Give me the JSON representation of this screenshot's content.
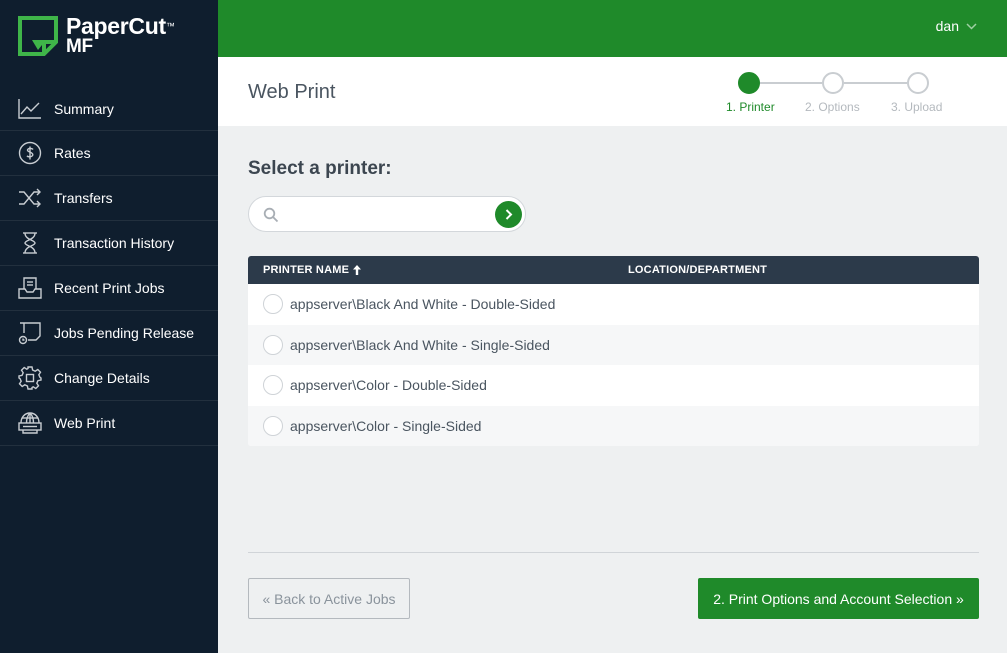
{
  "brand": {
    "name": "PaperCut",
    "trademark": "™",
    "edition": "MF",
    "colors": {
      "accent": "#1f8a2a",
      "sidebar": "#0f1e2e",
      "table_header": "#2c3a4a"
    }
  },
  "sidebar": {
    "items": [
      {
        "label": "Summary",
        "icon": "chart-line-icon"
      },
      {
        "label": "Rates",
        "icon": "dollar-circle-icon"
      },
      {
        "label": "Transfers",
        "icon": "shuffle-icon"
      },
      {
        "label": "Transaction History",
        "icon": "hourglass-icon"
      },
      {
        "label": "Recent Print Jobs",
        "icon": "tray-icon"
      },
      {
        "label": "Jobs Pending Release",
        "icon": "printer-pending-icon"
      },
      {
        "label": "Change Details",
        "icon": "gear-icon"
      },
      {
        "label": "Web Print",
        "icon": "globe-printer-icon"
      }
    ]
  },
  "header": {
    "user": "dan"
  },
  "page": {
    "title": "Web Print"
  },
  "stepper": {
    "steps": [
      {
        "label": "1. Printer",
        "active": true
      },
      {
        "label": "2. Options",
        "active": false
      },
      {
        "label": "3. Upload",
        "active": false
      }
    ]
  },
  "main": {
    "heading": "Select a printer:",
    "search": {
      "value": "",
      "placeholder": ""
    },
    "table": {
      "columns": [
        "PRINTER NAME",
        "LOCATION/DEPARTMENT"
      ],
      "sort": "ascending",
      "rows": [
        {
          "name": "appserver\\Black And White - Double-Sided",
          "location": ""
        },
        {
          "name": "appserver\\Black And White - Single-Sided",
          "location": ""
        },
        {
          "name": "appserver\\Color - Double-Sided",
          "location": ""
        },
        {
          "name": "appserver\\Color - Single-Sided",
          "location": ""
        }
      ]
    }
  },
  "footer": {
    "back_label": "« Back to Active Jobs",
    "next_label": "2. Print Options and Account Selection »"
  }
}
